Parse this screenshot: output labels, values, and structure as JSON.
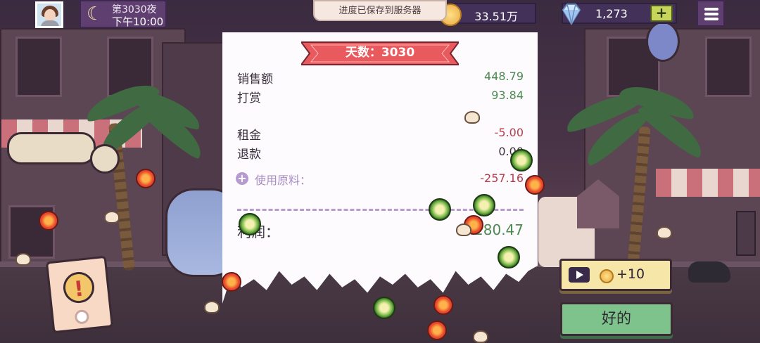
{
  "hud": {
    "night_label": "第3030夜",
    "time_label": "下午10:00",
    "save_toast": "进度已保存到服务器",
    "money": "33.51万",
    "gems": "1,273",
    "gem_plus": "+",
    "moon_icon": "☾"
  },
  "receipt": {
    "title": "天数：3030",
    "rows": [
      {
        "label": "销售额",
        "value": "448.79"
      },
      {
        "label": "打赏",
        "value": "93.84"
      },
      {
        "label": "租金",
        "value": "-5.00"
      },
      {
        "label": "退款",
        "value": "0.00"
      }
    ],
    "ingredients_label": "使用原料：",
    "ingredients_value": "-257.16",
    "ingredients_icon": "+",
    "profit_label": "利润：",
    "profit_value": "280.47"
  },
  "buttons": {
    "ad_reward": "+10",
    "ok": "好的"
  },
  "alert": {
    "symbol": "!"
  },
  "colors": {
    "positive": "#4c8a52",
    "negative": "#b83a4c",
    "ribbon": "#e85a5e",
    "ok_button": "#7fc38c",
    "ad_button": "#f6e7a8"
  }
}
